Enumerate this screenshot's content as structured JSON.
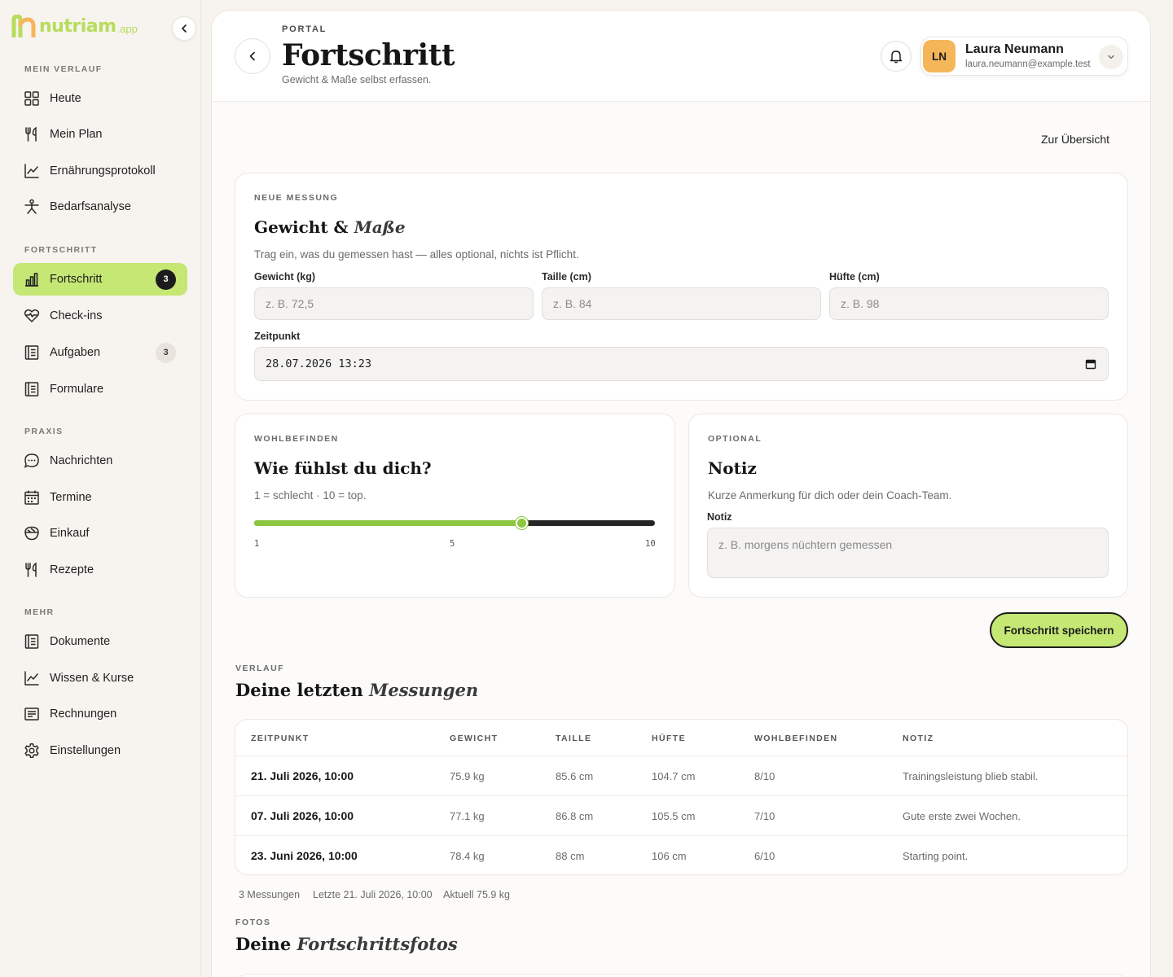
{
  "brand": {
    "name": "nutriam",
    "suffix": ".app",
    "color": "#b7dd5b"
  },
  "sidebar": {
    "sections": [
      {
        "label": "MEIN VERLAUF",
        "items": [
          {
            "label": "Heute",
            "icon": "grid-icon"
          },
          {
            "label": "Mein Plan",
            "icon": "fork-knife-icon"
          },
          {
            "label": "Ernährungsprotokoll",
            "icon": "trend-chart-icon"
          },
          {
            "label": "Bedarfsanalyse",
            "icon": "person-icon"
          }
        ]
      },
      {
        "label": "FORTSCHRITT",
        "items": [
          {
            "label": "Fortschritt",
            "icon": "bar-chart-icon",
            "badge": "3",
            "active": true
          },
          {
            "label": "Check-ins",
            "icon": "heart-pulse-icon"
          },
          {
            "label": "Aufgaben",
            "icon": "document-icon",
            "badge": "3"
          },
          {
            "label": "Formulare",
            "icon": "document-icon"
          }
        ]
      },
      {
        "label": "PRAXIS",
        "items": [
          {
            "label": "Nachrichten",
            "icon": "chat-bubble-icon"
          },
          {
            "label": "Termine",
            "icon": "calendar-icon"
          },
          {
            "label": "Einkauf",
            "icon": "basket-icon"
          },
          {
            "label": "Rezepte",
            "icon": "fork-knife-icon"
          }
        ]
      },
      {
        "label": "MEHR",
        "items": [
          {
            "label": "Dokumente",
            "icon": "document-icon"
          },
          {
            "label": "Wissen & Kurse",
            "icon": "trend-chart-icon"
          },
          {
            "label": "Rechnungen",
            "icon": "invoice-icon"
          },
          {
            "label": "Einstellungen",
            "icon": "gear-icon"
          }
        ]
      }
    ]
  },
  "header": {
    "eyebrow": "PORTAL",
    "title": "Fortschritt",
    "subtitle": "Gewicht & Maße selbst erfassen.",
    "user": {
      "initials": "LN",
      "name": "Laura Neumann",
      "email": "laura.neumann@example.test",
      "avatar_color": "#f5b65a"
    }
  },
  "overview_link": "Zur Übersicht",
  "measure_card": {
    "eyebrow": "NEUE MESSUNG",
    "title_plain": "Gewicht & ",
    "title_italic": "Maße",
    "description": "Trag ein, was du gemessen hast — alles optional, nichts ist Pflicht.",
    "fields": [
      {
        "label": "Gewicht (kg)",
        "placeholder": "z. B. 72,5"
      },
      {
        "label": "Taille (cm)",
        "placeholder": "z. B. 84"
      },
      {
        "label": "Hüfte (cm)",
        "placeholder": "z. B. 98"
      }
    ],
    "datetime": {
      "label": "Zeitpunkt",
      "value": "28.07.2026 13:23"
    }
  },
  "wellbeing_card": {
    "eyebrow": "WOHLBEFINDEN",
    "title": "Wie fühlst du dich?",
    "description": "1 = schlecht · 10 = top.",
    "slider": {
      "min": 1,
      "max": 10,
      "value": 7,
      "ticks": [
        "1",
        "5",
        "10"
      ]
    },
    "accent": "#8cc63f"
  },
  "note_card": {
    "eyebrow": "OPTIONAL",
    "title": "Notiz",
    "description": "Kurze Anmerkung für dich oder dein Coach-Team.",
    "label": "Notiz",
    "placeholder": "z. B. morgens nüchtern gemessen"
  },
  "save_button": "Fortschritt speichern",
  "history": {
    "eyebrow": "VERLAUF",
    "title_plain": "Deine letzten ",
    "title_italic": "Messungen",
    "columns": [
      "ZEITPUNKT",
      "GEWICHT",
      "TAILLE",
      "HÜFTE",
      "WOHLBEFINDEN",
      "NOTIZ"
    ],
    "rows": [
      [
        "21. Juli 2026, 10:00",
        "75.9 kg",
        "85.6 cm",
        "104.7 cm",
        "8/10",
        "Trainingsleistung blieb stabil."
      ],
      [
        "07. Juli 2026, 10:00",
        "77.1 kg",
        "86.8 cm",
        "105.5 cm",
        "7/10",
        "Gute erste zwei Wochen."
      ],
      [
        "23. Juni 2026, 10:00",
        "78.4 kg",
        "88 cm",
        "106 cm",
        "6/10",
        "Starting point."
      ]
    ],
    "summary": [
      "3 Messungen",
      "Letzte 21. Juli 2026, 10:00",
      "Aktuell 75.9 kg"
    ]
  },
  "photos": {
    "eyebrow": "FOTOS",
    "title_plain": "Deine ",
    "title_italic": "Fortschrittsfotos"
  }
}
